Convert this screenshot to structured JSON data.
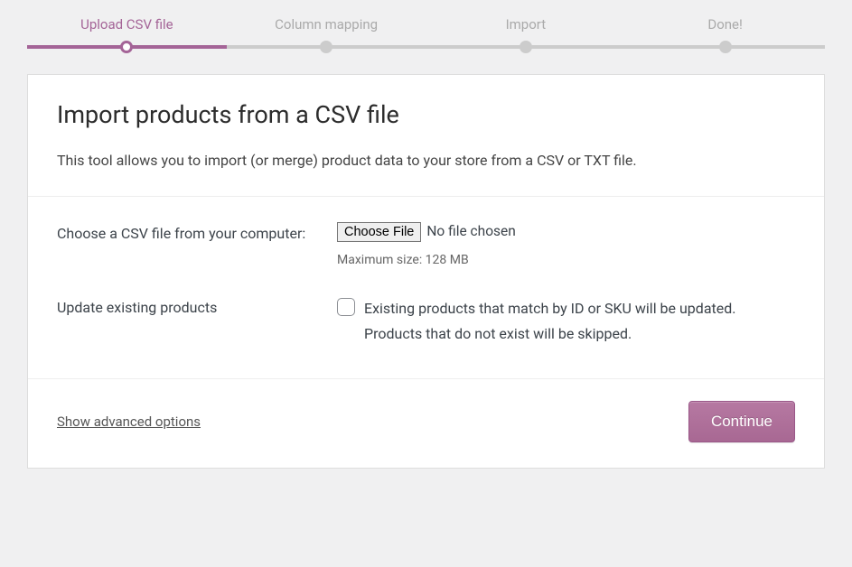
{
  "stepper": {
    "steps": [
      {
        "label": "Upload CSV file",
        "active": true
      },
      {
        "label": "Column mapping",
        "active": false
      },
      {
        "label": "Import",
        "active": false
      },
      {
        "label": "Done!",
        "active": false
      }
    ]
  },
  "header": {
    "title": "Import products from a CSV file",
    "subtitle": "This tool allows you to import (or merge) product data to your store from a CSV or TXT file."
  },
  "form": {
    "file": {
      "label": "Choose a CSV file from your computer:",
      "button_label": "Choose File",
      "status": "No file chosen",
      "hint": "Maximum size: 128 MB"
    },
    "update_existing": {
      "label": "Update existing products",
      "description": "Existing products that match by ID or SKU will be updated. Products that do not exist will be skipped.",
      "checked": false
    }
  },
  "footer": {
    "advanced_link": "Show advanced options",
    "continue_label": "Continue"
  }
}
